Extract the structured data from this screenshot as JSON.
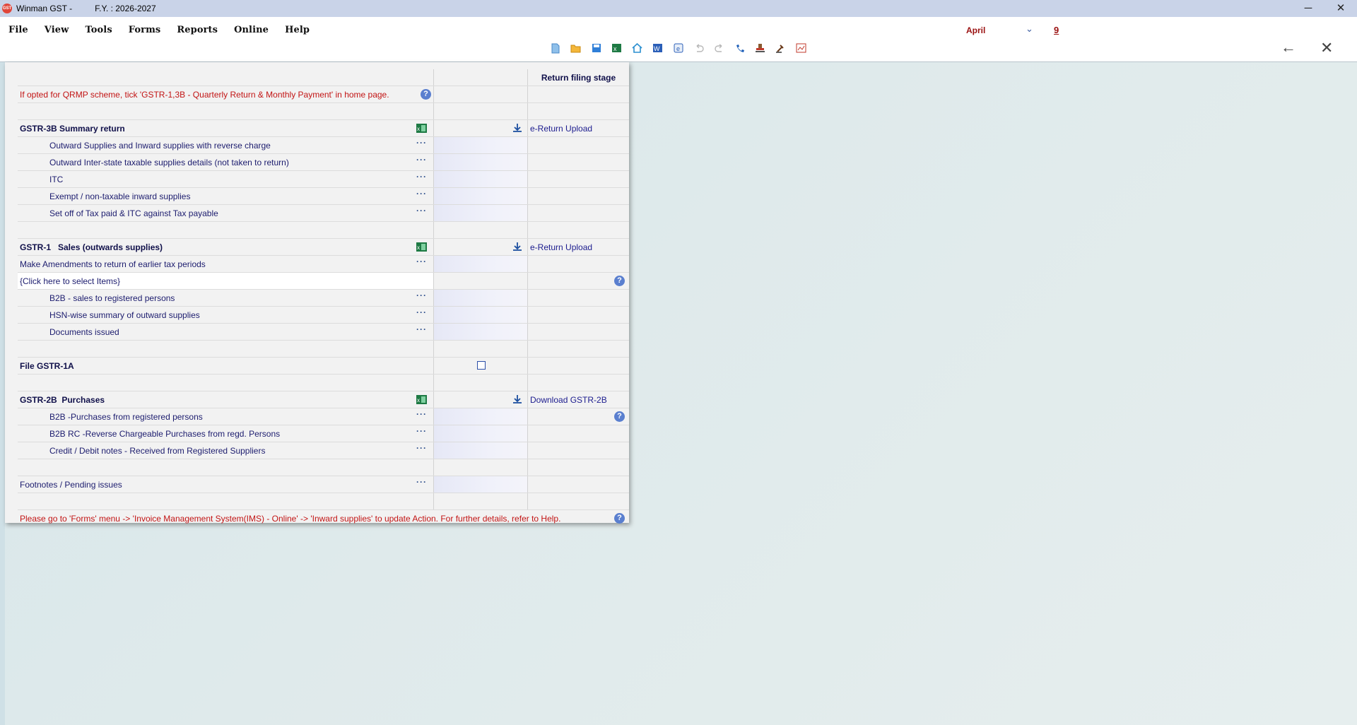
{
  "titlebar": {
    "app_title": "Winman GST -",
    "fy": "F.Y. : 2026-2027",
    "minimize": "─",
    "maximize": "☐",
    "close": "✕"
  },
  "menu": [
    "File",
    "View",
    "Tools",
    "Forms",
    "Reports",
    "Online",
    "Help"
  ],
  "toolbar_icons": [
    "new-file-icon",
    "open-folder-icon",
    "save-icon",
    "excel-icon",
    "home-icon",
    "word-icon",
    "edge-browser-icon",
    "undo-icon",
    "redo-icon",
    "phone-icon",
    "stamp-icon",
    "gavel-icon",
    "chart-image-icon"
  ],
  "period": {
    "month": "April",
    "day": "9"
  },
  "nav": {
    "back": "←",
    "close": "✕"
  },
  "grid": {
    "header_stage": "Return filing stage",
    "qrmp_note": "If opted for QRMP scheme, tick 'GSTR-1,3B - Quarterly Return & Monthly Payment' in home page.",
    "gstr3b": {
      "title": "GSTR-3B Summary return",
      "action": "e-Return Upload",
      "items": [
        "Outward Supplies and Inward supplies with reverse charge",
        "Outward Inter-state taxable supplies details (not taken to return)",
        "ITC",
        "Exempt / non-taxable inward supplies",
        "Set off of Tax paid & ITC against Tax payable"
      ]
    },
    "gstr1": {
      "title": "GSTR-1   Sales (outwards supplies)",
      "action": "e-Return Upload",
      "amend": "Make Amendments to return of earlier tax periods",
      "select": "{Click here to select Items}",
      "items": [
        "B2B - sales to registered persons",
        "HSN-wise summary of outward supplies",
        "Documents issued"
      ]
    },
    "gstr1a": {
      "title": "File GSTR-1A",
      "checked": false
    },
    "gstr2b": {
      "title": "GSTR-2B  Purchases",
      "action": "Download GSTR-2B",
      "items": [
        "B2B -Purchases from registered persons",
        "B2B RC -Reverse Chargeable Purchases from regd. Persons",
        "Credit / Debit notes - Received from Registered Suppliers"
      ]
    },
    "footnotes": "Footnotes / Pending issues",
    "ims_note": "Please go to 'Forms' menu -> 'Invoice Management System(IMS) - Online' -> 'Inward supplies' to update Action. For further details, refer to Help.",
    "dots": "···",
    "help": "?"
  }
}
